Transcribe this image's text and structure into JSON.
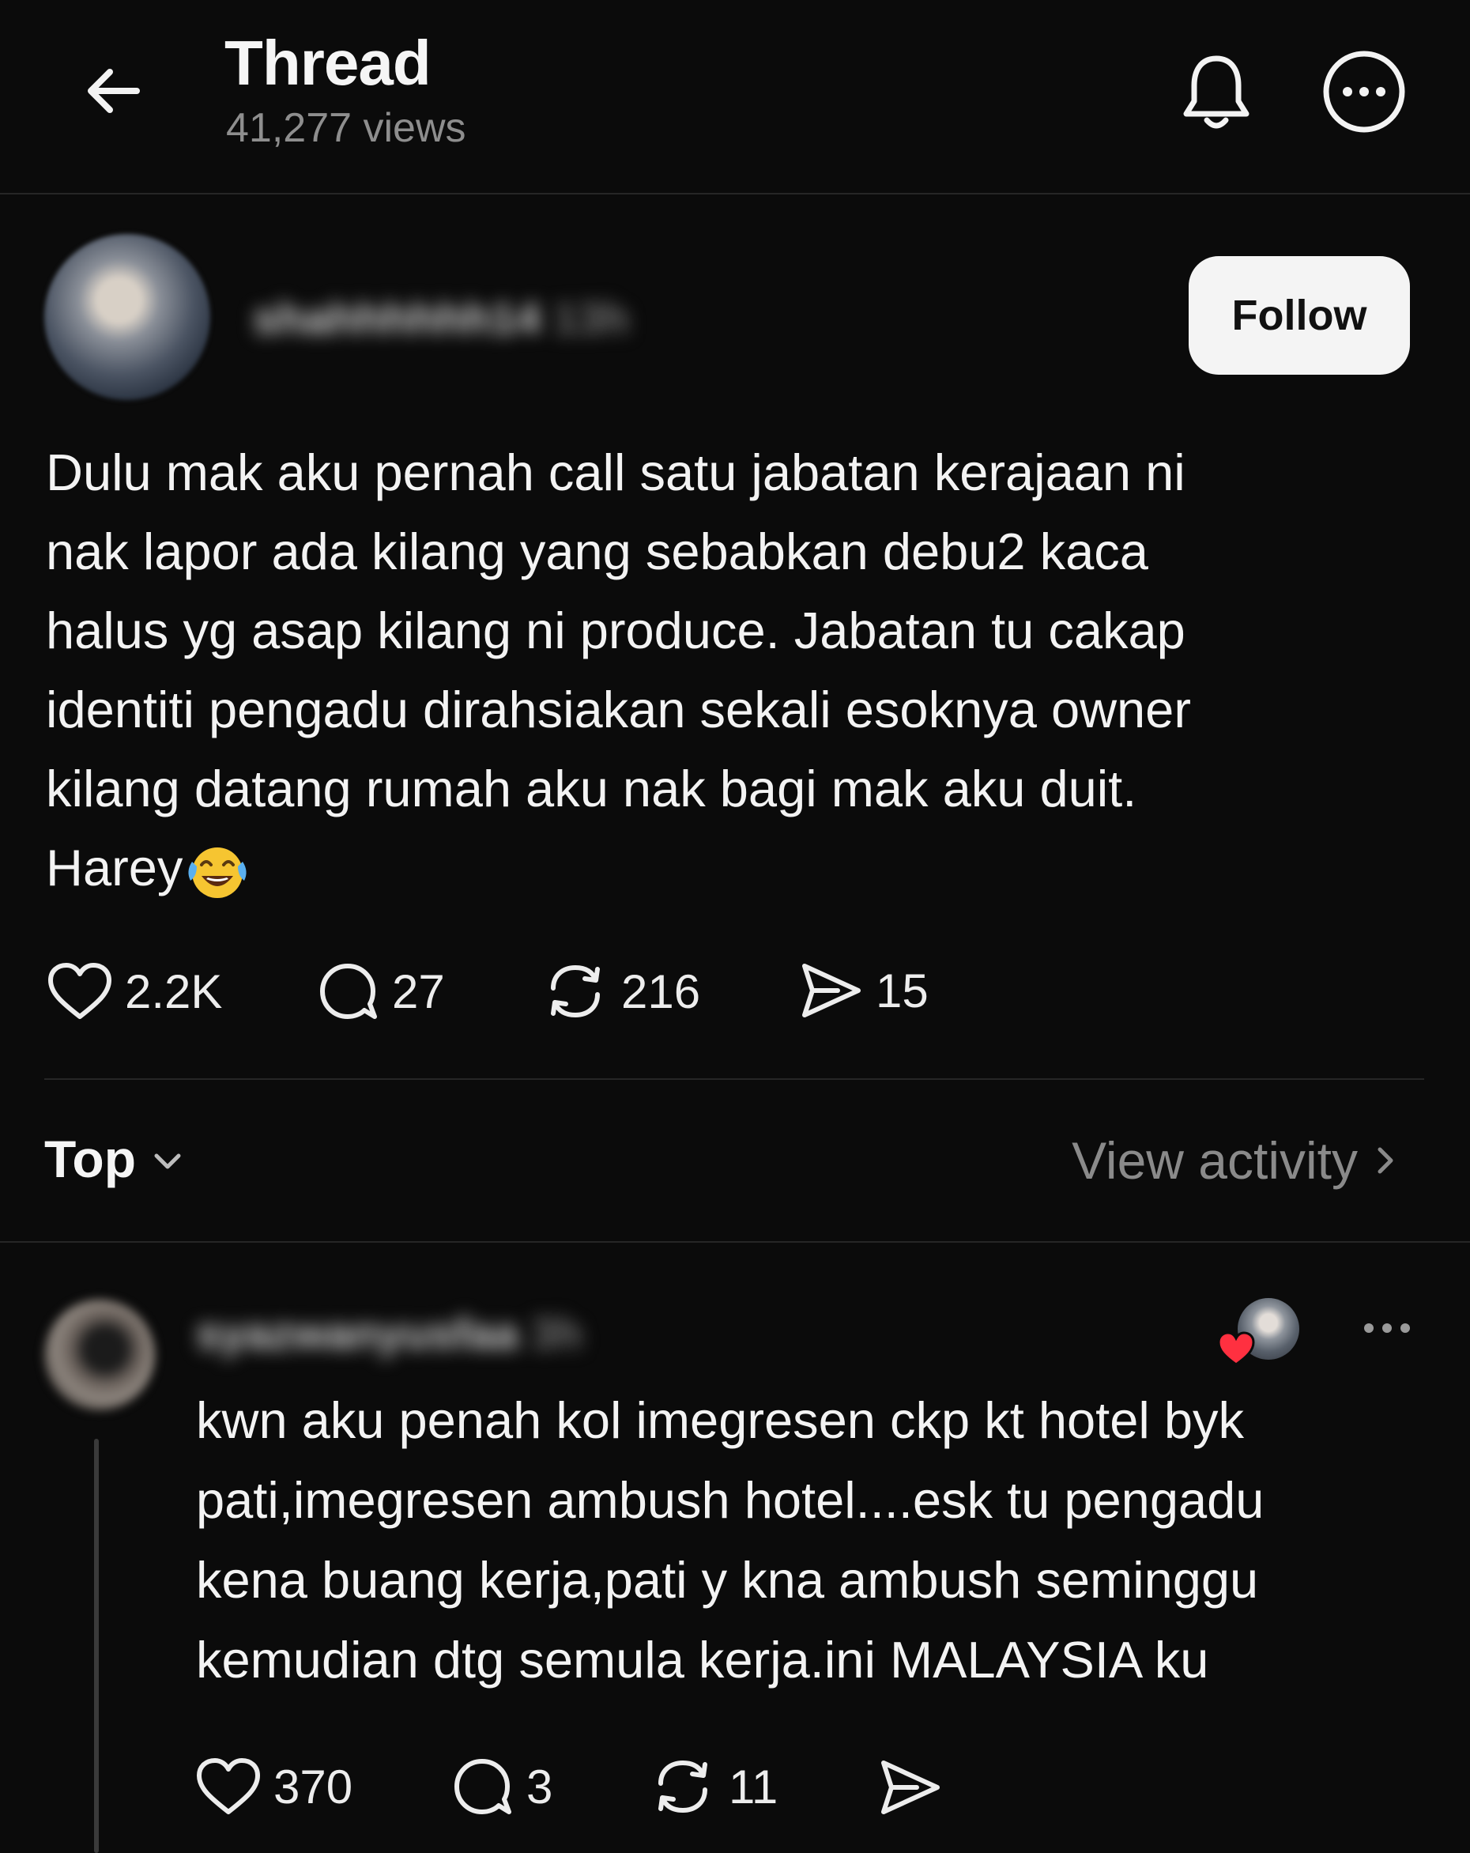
{
  "header": {
    "title": "Thread",
    "views": "41,277 views",
    "icons": {
      "back": "back-arrow-icon",
      "bell": "bell-icon",
      "more": "more-circle-icon"
    }
  },
  "post": {
    "username": "shahhhhhh14",
    "time": "13h",
    "follow_label": "Follow",
    "text_lines": [
      "Dulu mak aku pernah call satu jabatan kerajaan ni",
      "nak lapor ada kilang yang sebabkan debu2 kaca",
      "halus yg asap kilang ni produce. Jabatan tu cakap",
      "identiti pengadu dirahsiakan sekali esoknya owner",
      "kilang datang rumah aku nak bagi mak aku duit.",
      "Harey"
    ],
    "emoji": "face-with-tears-of-joy",
    "stats": {
      "likes": "2.2K",
      "replies": "27",
      "reposts": "216",
      "shares": "15"
    }
  },
  "sort": {
    "label": "Top",
    "view_activity": "View activity"
  },
  "reply": {
    "username": "syazwanyusfaa",
    "time": "3h",
    "text_lines": [
      "kwn aku penah kol imegresen ckp kt hotel byk",
      "pati,imegresen ambush hotel....esk tu pengadu",
      "kena buang kerja,pati y kna ambush seminggu",
      "kemudian dtg semula kerja.ini MALAYSIA ku"
    ],
    "stats": {
      "likes": "370",
      "replies": "3",
      "reposts": "11"
    }
  },
  "colors": {
    "background": "#0b0b0b",
    "text": "#f3f3f3",
    "muted": "#8e8e8e",
    "heart": "#ff3040"
  }
}
